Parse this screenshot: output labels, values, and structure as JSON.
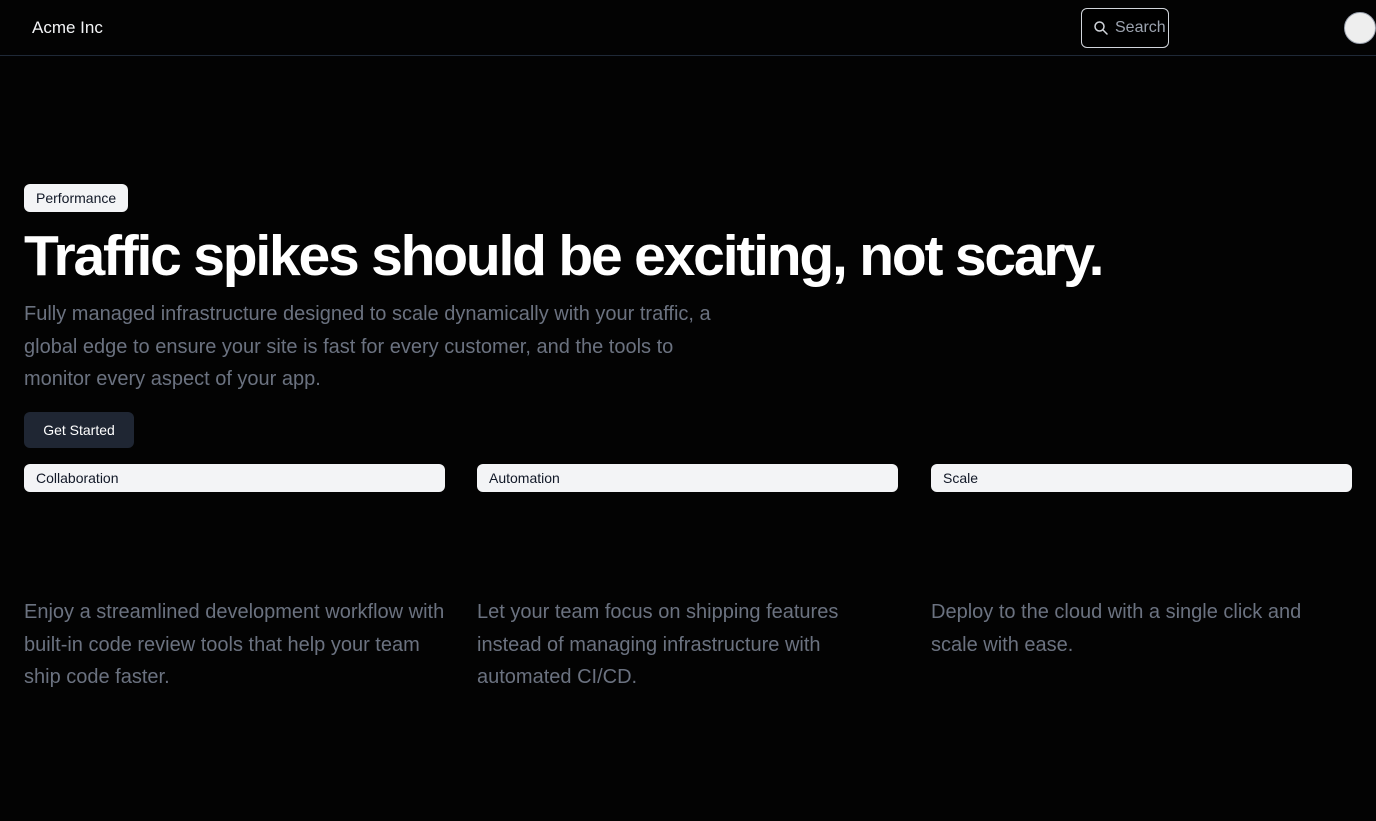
{
  "header": {
    "brand": "Acme Inc",
    "search_placeholder": "Search"
  },
  "hero": {
    "badge": "Performance",
    "headline": "Traffic spikes should be exciting, not scary.",
    "description": "Fully managed infrastructure designed to scale dynamically with your traffic, a global edge to ensure your site is fast for every customer, and the tools to monitor every aspect of your app.",
    "cta_label": "Get Started"
  },
  "features": [
    {
      "label": "Collaboration",
      "description": "Enjoy a streamlined development workflow with built-in code review tools that help your team ship code faster."
    },
    {
      "label": "Automation",
      "description": "Let your team focus on shipping features instead of managing infrastructure with automated CI/CD."
    },
    {
      "label": "Scale",
      "description": "Deploy to the cloud with a single click and scale with ease."
    }
  ],
  "icons": {
    "search": "search-icon"
  },
  "colors": {
    "background": "#030303",
    "muted_text": "#6b7280",
    "badge_background": "#f3f4f6",
    "button_background": "#1f2633"
  }
}
